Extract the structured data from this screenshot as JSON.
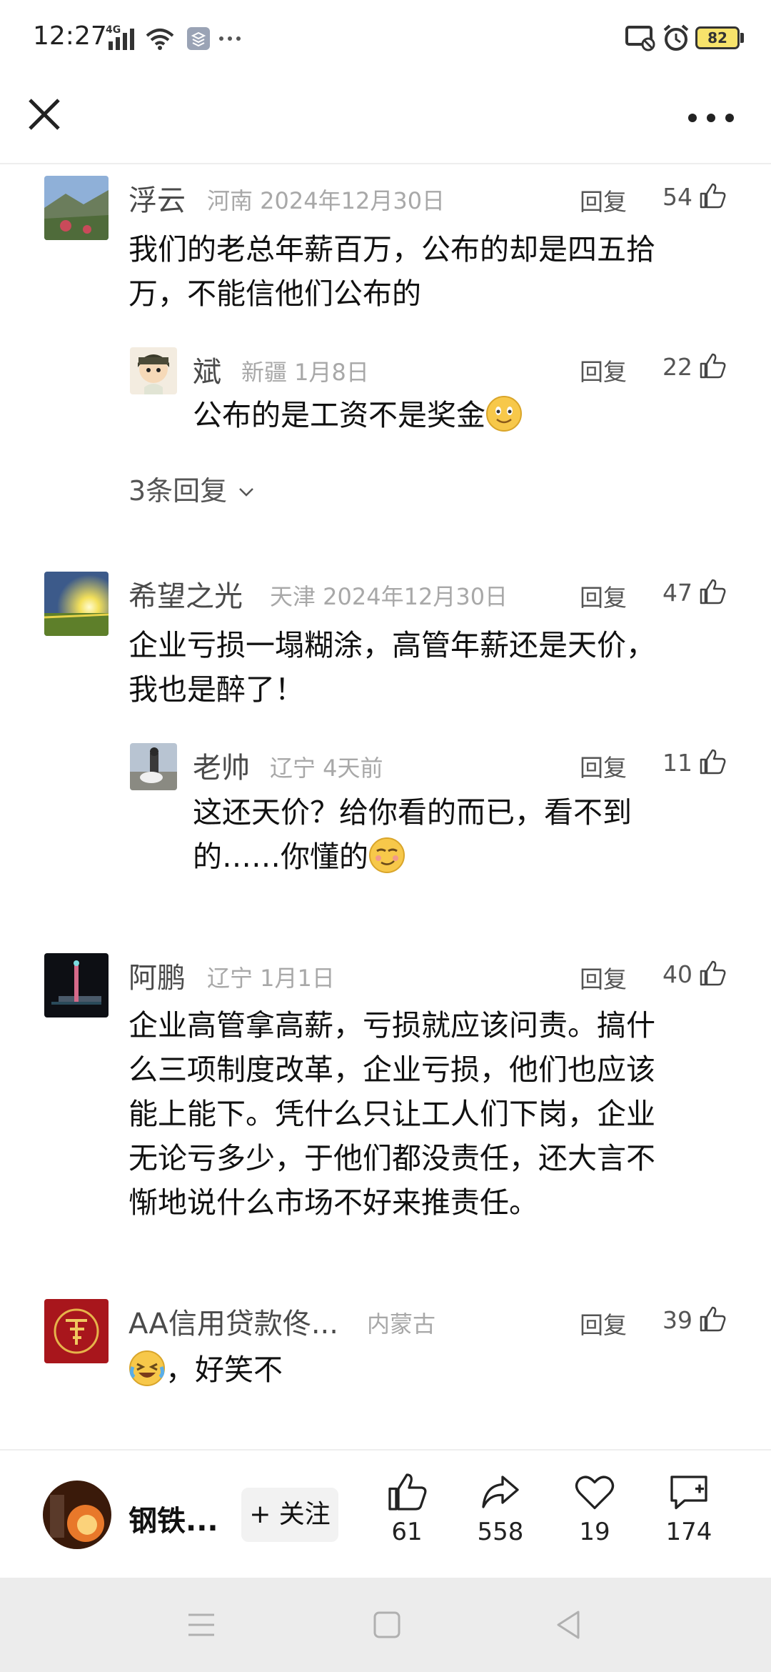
{
  "status_bar": {
    "time": "12:27",
    "network": "4G",
    "battery": "82"
  },
  "nav": {
    "close_icon": "close-icon",
    "more_icon": "more-dots-icon"
  },
  "comments": [
    {
      "username": "浮云",
      "location_date": "河南 2024年12月30日",
      "reply_label": "回复",
      "likes": "54",
      "text": [
        "我们的老总年薪百万，公布的却是四五拾",
        "万，不能信他们公布的"
      ],
      "replies": [
        {
          "username": "斌",
          "location_date": "新疆 1月8日",
          "reply_label": "回复",
          "likes": "22",
          "text": [
            "公布的是工资不是奖金"
          ]
        }
      ],
      "more_replies": "3条回复"
    },
    {
      "username": "希望之光",
      "location_date": "天津 2024年12月30日",
      "reply_label": "回复",
      "likes": "47",
      "text": [
        "企业亏损一塌糊涂，高管年薪还是天价，",
        "我也是醉了！"
      ],
      "replies": [
        {
          "username": "老帅",
          "location_date": "辽宁 4天前",
          "reply_label": "回复",
          "likes": "11",
          "text": [
            "这还天价？给你看的而已，看不到",
            "的……你懂的"
          ]
        }
      ]
    },
    {
      "username": "阿鹏",
      "location_date": "辽宁 1月1日",
      "reply_label": "回复",
      "likes": "40",
      "text": [
        "企业高管拿高薪，亏损就应该问责。搞什",
        "么三项制度改革，企业亏损，他们也应该",
        "能上能下。凭什么只让工人们下岗，企业",
        "无论亏多少，于他们都没责任，还大言不",
        "惭地说什么市场不好来推责任。"
      ]
    },
    {
      "username": "AA信用贷款佟...",
      "location_date": "内蒙古",
      "reply_label": "回复",
      "likes": "39",
      "text": [
        "，好笑不"
      ]
    }
  ],
  "bottom_bar": {
    "author": "钢铁...",
    "follow": "+ 关注",
    "likes": "61",
    "shares": "558",
    "favorites": "19",
    "comments": "174"
  }
}
